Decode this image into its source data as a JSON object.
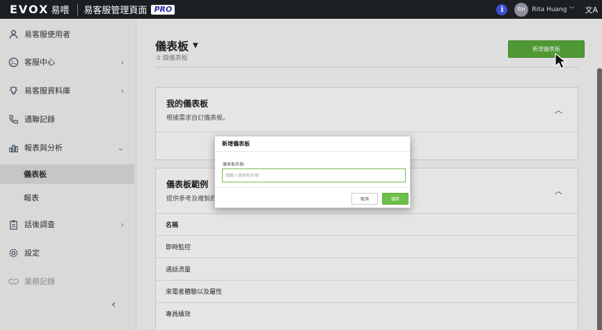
{
  "topbar": {
    "logo_en": "EVOX",
    "logo_zh": "易喂",
    "app_title": "易客服管理頁面",
    "badge": "PRO",
    "info_glyph": "i",
    "user_initials": "RH",
    "user_name": "Rita Huang",
    "caret_glyph": "﹀",
    "lang_glyph": "文A"
  },
  "sidebar": {
    "items": [
      {
        "label": "易客服使用者",
        "icon": "user-icon"
      },
      {
        "label": "客服中心",
        "icon": "headset-icon"
      },
      {
        "label": "易客服資料庫",
        "icon": "bulb-icon"
      },
      {
        "label": "通聯記錄",
        "icon": "phone-icon"
      },
      {
        "label": "報表與分析",
        "icon": "bar-chart-icon"
      },
      {
        "label": "話後調查",
        "icon": "clipboard-icon"
      },
      {
        "label": "設定",
        "icon": "gear-icon"
      },
      {
        "label": "業務記錄",
        "icon": "handshake-icon"
      }
    ],
    "sub_items": [
      {
        "label": "儀表板"
      },
      {
        "label": "報表"
      }
    ],
    "chevron_right": "›",
    "chevron_down": "⌄",
    "collapse_glyph": "‹"
  },
  "main": {
    "title": "儀表板",
    "title_caret": "▼",
    "subtitle": "0 個儀表板",
    "add_button": "新增儀表板",
    "my_card": {
      "title": "我的儀表板",
      "desc": "根據需求自訂儀表板。",
      "toggle": "︿"
    },
    "examples_card": {
      "title": "儀表板範例",
      "desc": "提供參考及複製的",
      "toggle": "︿",
      "header": "名稱",
      "rows": [
        "即時監控",
        "通話流量",
        "來電者體驗以及屬性",
        "專員績效"
      ]
    }
  },
  "modal": {
    "title": "新增儀表板",
    "label": "儀表板名稱:",
    "placeholder": "請輸入儀表板名稱",
    "cancel": "取消",
    "save": "儲存"
  }
}
